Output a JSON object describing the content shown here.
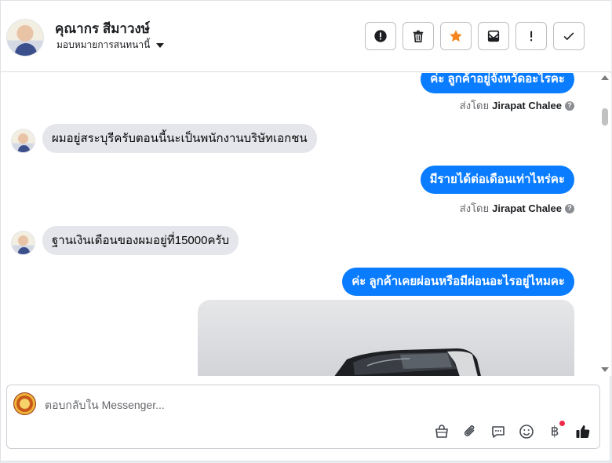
{
  "header": {
    "contact_name": "คุณากร สีมาวงษ์",
    "assign_label": "มอบหมายการสนทนานี้",
    "actions": [
      {
        "icon": "alert-circle-icon",
        "name": "mark-spam-button"
      },
      {
        "icon": "trash-icon",
        "name": "delete-button"
      },
      {
        "icon": "star-icon",
        "name": "star-button"
      },
      {
        "icon": "mark-unread-icon",
        "name": "mark-unread-button"
      },
      {
        "icon": "exclamation-icon",
        "name": "follow-up-button"
      },
      {
        "icon": "check-icon",
        "name": "mark-done-button"
      }
    ],
    "star_color": "#f5851f"
  },
  "messages": {
    "m1_text": "ค่ะ ลูกค้าอยู่จังหวัดอะไรคะ",
    "m1_sent_prefix": "ส่งโดย",
    "m1_sender": "Jirapat Chalee",
    "m2_text": "ผมอยู่สระบุรีครับตอนนี้นะเป็นพนักงานบริษัทเอกชน",
    "m3_text": "มีรายได้ต่อเดือนเท่าไหร่คะ",
    "m3_sent_prefix": "ส่งโดย",
    "m3_sender": "Jirapat Chalee",
    "m4_text": "ฐานเงินเดือนของผมอยู่ที่15000ครับ",
    "m5_text": "ค่ะ  ลูกค้าเคยผ่อนหรือมีผ่อนอะไรอยู่ไหมคะ",
    "help_glyph": "?",
    "outgoing_color": "#0a7cff",
    "incoming_color": "#e4e6eb"
  },
  "composer": {
    "placeholder": "ตอบกลับใน Messenger...",
    "currency_symbol": "฿",
    "tools": [
      "shopping-bag-icon",
      "paperclip-icon",
      "saved-reply-icon",
      "emoji-icon",
      "payment-icon",
      "thumbs-up-icon"
    ]
  }
}
